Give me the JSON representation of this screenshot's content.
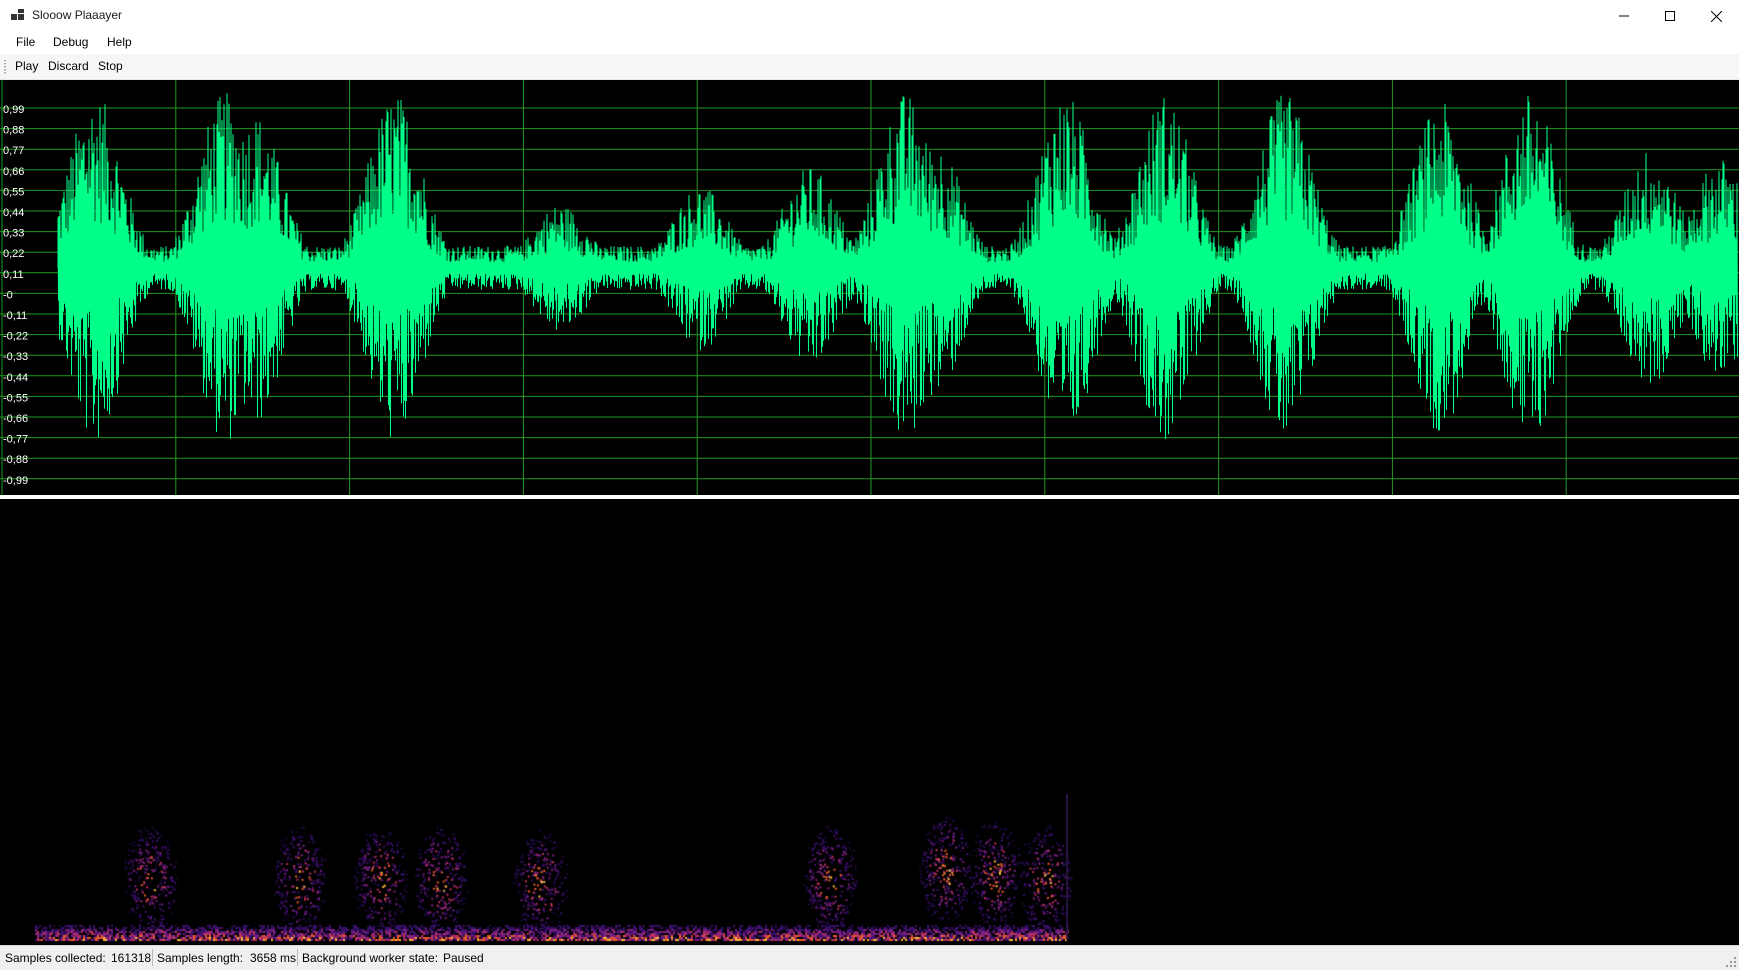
{
  "window": {
    "title": "Slooow Plaaayer"
  },
  "menu": {
    "items": [
      "File",
      "Debug",
      "Help"
    ]
  },
  "toolbar": {
    "play": "Play",
    "discard": "Discard",
    "stop": "Stop"
  },
  "waveform": {
    "y_labels": [
      "0,99",
      "0,88",
      "0,77",
      "0,66",
      "0,55",
      "0,44",
      "0,33",
      "0,22",
      "0,11",
      "-0",
      "-0,11",
      "-0,22",
      "-0,33",
      "-0,44",
      "-0,55",
      "-0,66",
      "-0,77",
      "-0,88",
      "-0,99"
    ],
    "wave_color": "#00ff88",
    "grid_color": "#1f9a1f",
    "background": "#000000"
  },
  "status": {
    "samples_collected_label": "Samples collected:",
    "samples_collected_value": "161318",
    "samples_length_label": "Samples length:",
    "samples_length_value": "3658 ms",
    "worker_state_label": "Background worker state:",
    "worker_state_value": "Paused"
  }
}
